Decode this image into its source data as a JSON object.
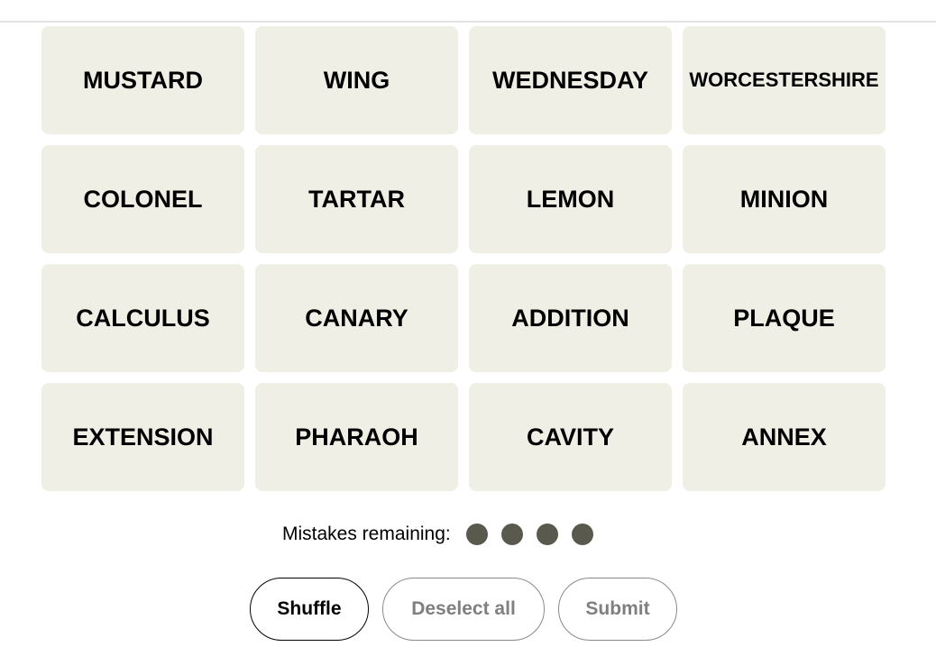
{
  "tiles": [
    "MUSTARD",
    "WING",
    "WEDNESDAY",
    "WORCESTERSHIRE",
    "COLONEL",
    "TARTAR",
    "LEMON",
    "MINION",
    "CALCULUS",
    "CANARY",
    "ADDITION",
    "PLAQUE",
    "EXTENSION",
    "PHARAOH",
    "CAVITY",
    "ANNEX"
  ],
  "mistakes": {
    "label": "Mistakes remaining:",
    "remaining": 4,
    "dot_color": "#5a594e"
  },
  "buttons": {
    "shuffle": "Shuffle",
    "deselect_all": "Deselect all",
    "submit": "Submit"
  },
  "colors": {
    "tile_bg": "#efefe6",
    "disabled_text": "#7f7f7f"
  }
}
